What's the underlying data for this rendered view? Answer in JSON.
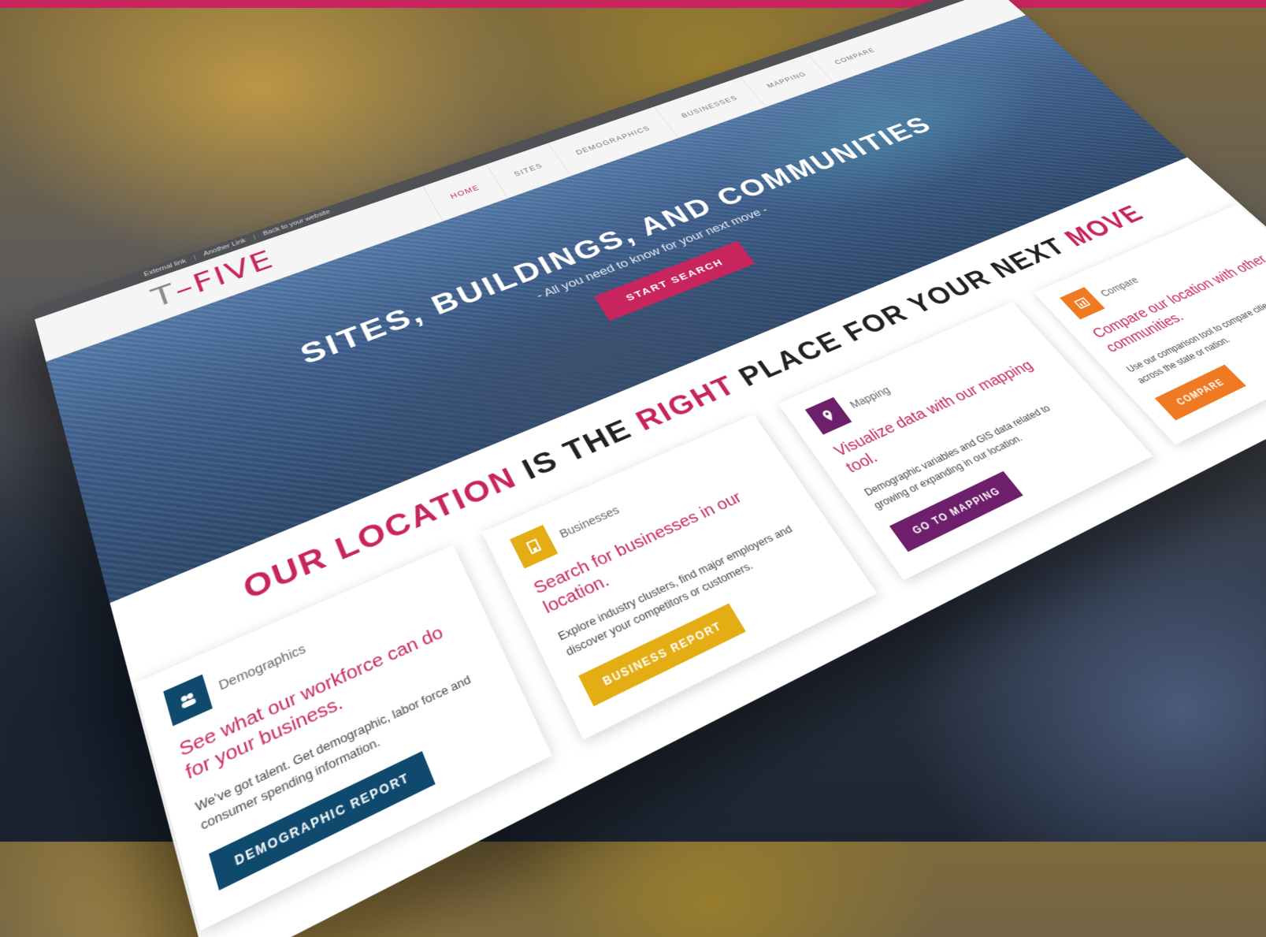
{
  "colors": {
    "brand": "#c8255e",
    "demographics": "#0f4a6e",
    "businesses": "#e5ad14",
    "mapping": "#6e1f6b",
    "compare": "#f07a22"
  },
  "utility_links": [
    "External link",
    "Another Link",
    "Back to your website"
  ],
  "utility_separator": "|",
  "logo": {
    "t": "T",
    "dash": "–",
    "five": "FIVE"
  },
  "nav": [
    {
      "label": "HOME",
      "active": true
    },
    {
      "label": "SITES",
      "active": false
    },
    {
      "label": "DEMOGRAPHICS",
      "active": false
    },
    {
      "label": "BUSINESSES",
      "active": false
    },
    {
      "label": "MAPPING",
      "active": false
    },
    {
      "label": "COMPARE",
      "active": false
    }
  ],
  "hero": {
    "title": "SITES, BUILDINGS, AND COMMUNITIES",
    "subtitle": "- All you need to know for your next move -",
    "button": "START SEARCH"
  },
  "location": {
    "part1": "OUR LOCATION",
    "part2": " IS THE ",
    "part3": "RIGHT",
    "part4": " PLACE FOR YOUR NEXT ",
    "part5": "MOVE"
  },
  "cards": [
    {
      "label": "Demographics",
      "icon": "people-icon",
      "headline": "See what our workforce can do for your business.",
      "body": "We've got talent. Get demographic, labor force and consumer spending information.",
      "button": "DEMOGRAPHIC REPORT"
    },
    {
      "label": "Businesses",
      "icon": "building-icon",
      "headline": "Search for businesses in our location.",
      "body": "Explore industry clusters, find major employers and discover your competitors or customers.",
      "button": "BUSINESS REPORT"
    },
    {
      "label": "Mapping",
      "icon": "map-pin-icon",
      "headline": "Visualize data with our mapping tool.",
      "body": "Demographic variables and GIS data related to growing or expanding in our location.",
      "button": "GO TO MAPPING"
    },
    {
      "label": "Compare",
      "icon": "compare-icon",
      "headline": "Compare our location with other communities.",
      "body": "Use our comparison tool to compare cities or counties across the state or nation.",
      "button": "COMPARE"
    }
  ]
}
